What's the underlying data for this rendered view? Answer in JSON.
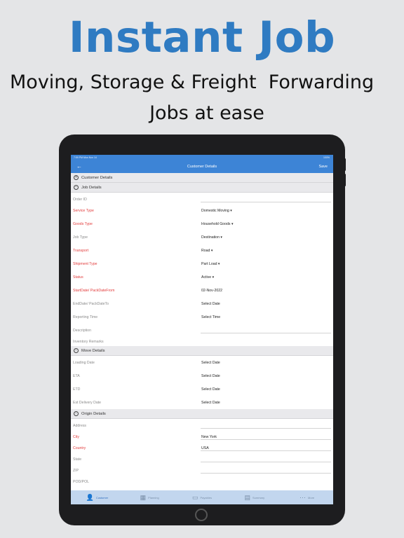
{
  "promo": {
    "headline": "Instant Job",
    "subline1": "Moving, Storage & Freight  Forwarding",
    "subline2": "Jobs at ease"
  },
  "status_bar": {
    "time": "7:59 PM  Mon Nov 14",
    "right": "100%"
  },
  "nav": {
    "back_icon": "←",
    "title": "Customer Details",
    "save": "Save"
  },
  "sections": {
    "customer": {
      "icon": "+",
      "title": "Customer Details"
    },
    "job": {
      "icon": "−",
      "title": "Job Details"
    },
    "move": {
      "icon": "−",
      "title": "Move Details"
    },
    "origin": {
      "icon": "−",
      "title": "Origin Details"
    }
  },
  "job_fields": [
    {
      "label": "Order ID",
      "value": ""
    },
    {
      "label": "Service Type",
      "value": "Domestic Moving ▾"
    },
    {
      "label": "Goods Type",
      "value": "Household Goods ▾"
    },
    {
      "label": "Job Type",
      "value": "Destination ▾"
    },
    {
      "label": "Transport",
      "value": "Road ▾"
    },
    {
      "label": "Shipment Type",
      "value": "Part Load ▾"
    },
    {
      "label": "Status",
      "value": "Active ▾"
    },
    {
      "label": "StartDate/ PackDateFrom",
      "value": "02-Nov-2022"
    },
    {
      "label": "EndDate/ PackDateTo",
      "value": "Select Date"
    },
    {
      "label": "Reporting Time",
      "value": "Select Time"
    },
    {
      "label": "Description",
      "value": ""
    },
    {
      "label": "Inventory Remarks",
      "value": ""
    }
  ],
  "move_fields": [
    {
      "label": "Loading Date",
      "value": "Select Date"
    },
    {
      "label": "ETA",
      "value": "Select Date"
    },
    {
      "label": "ETD",
      "value": "Select Date"
    },
    {
      "label": "Est Delivery Date",
      "value": "Select Date"
    }
  ],
  "origin_fields": [
    {
      "label": "Address",
      "value": ""
    },
    {
      "label": "City",
      "value": "New York"
    },
    {
      "label": "Country",
      "value": "USA"
    },
    {
      "label": "State",
      "value": ""
    },
    {
      "label": "ZIP",
      "value": ""
    },
    {
      "label": "POD/POL",
      "value": ""
    }
  ],
  "tabs": [
    {
      "icon": "person-icon",
      "glyph": "👤",
      "label": "Customer"
    },
    {
      "icon": "planning-icon",
      "glyph": "▦",
      "label": "Planning"
    },
    {
      "icon": "payables-icon",
      "glyph": "▭",
      "label": "Payables"
    },
    {
      "icon": "summary-icon",
      "glyph": "▤",
      "label": "Summary"
    },
    {
      "icon": "more-icon",
      "glyph": "⋯",
      "label": "More"
    }
  ],
  "colors": {
    "headline": "#2f7bc2",
    "nav_bar": "#3d84d6",
    "required_label": "#e23b3b",
    "tab_bar": "#c2d6ee"
  }
}
